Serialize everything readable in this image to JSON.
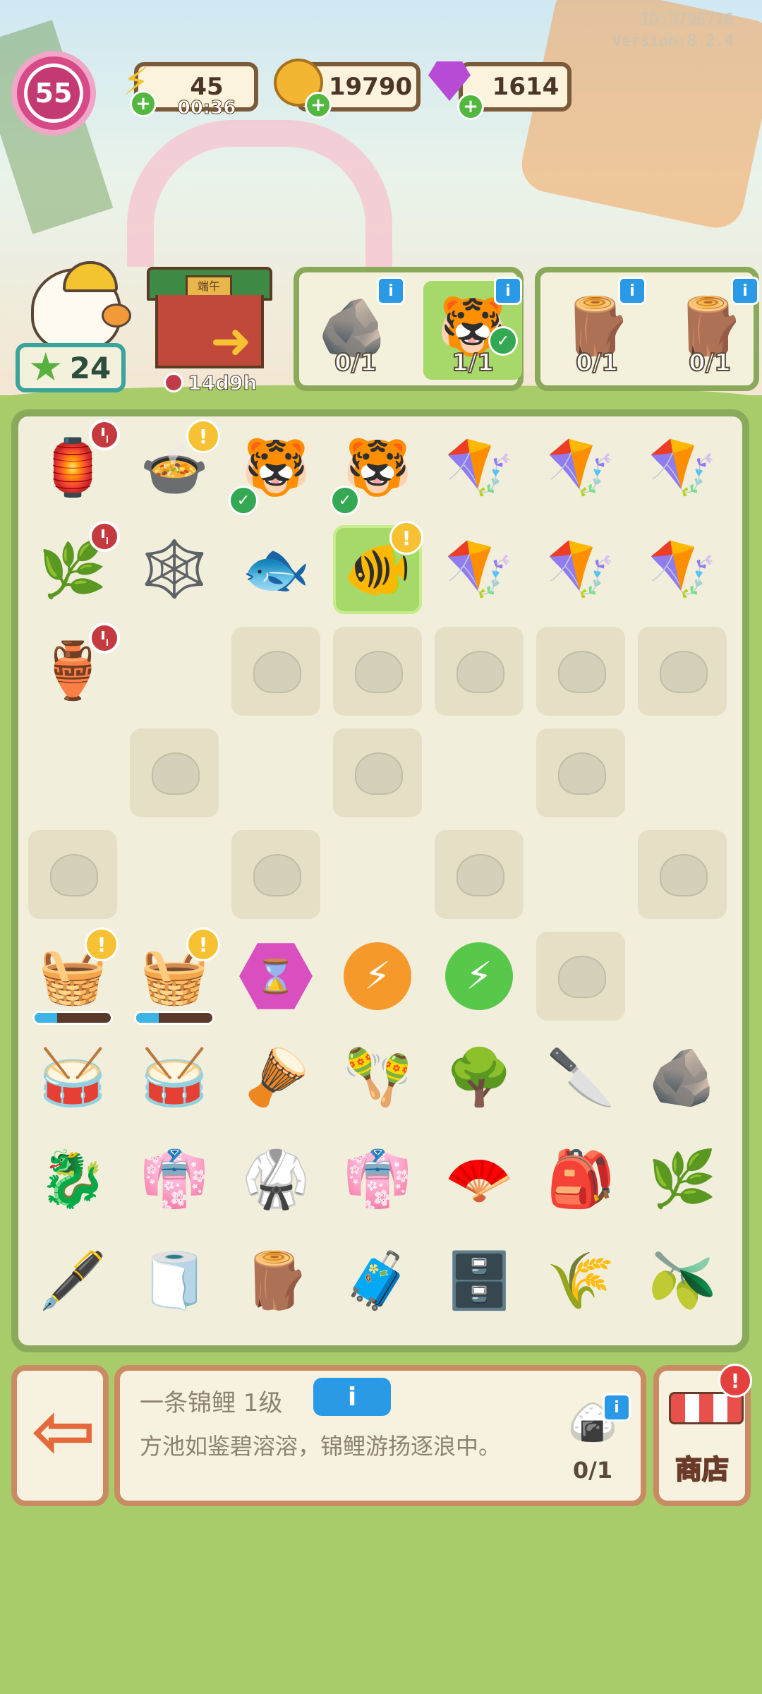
{
  "meta": {
    "id_text": "ID:3796716",
    "version_text": "Version:8.2.4"
  },
  "hud": {
    "level": "55",
    "energy": {
      "value": "45",
      "timer": "00:36"
    },
    "coins": {
      "value": "19790"
    },
    "gems": {
      "value": "1614"
    }
  },
  "player": {
    "star_count": "24"
  },
  "event": {
    "sign_text": "端午",
    "timer": "14d9h"
  },
  "orders": [
    {
      "items": [
        {
          "icon": "ink-stone",
          "count": "0/1",
          "done": false
        },
        {
          "icon": "tiger-sachet",
          "count": "1/1",
          "done": true
        }
      ]
    },
    {
      "items": [
        {
          "icon": "wood-plank",
          "count": "0/1",
          "done": false
        },
        {
          "icon": "wood-pile",
          "count": "0/1",
          "done": false
        }
      ]
    }
  ],
  "board": {
    "rows": [
      [
        {
          "icon": "market-stall",
          "emoji": "🏮",
          "badge": "clock"
        },
        {
          "icon": "cauldron",
          "emoji": "🍲",
          "badge": "excl"
        },
        {
          "icon": "tiger-sachet",
          "emoji": "🐯",
          "badge": "check"
        },
        {
          "icon": "tiger-sachet",
          "emoji": "🐯",
          "badge": "check"
        },
        {
          "icon": "swallow-kite",
          "emoji": "🪁"
        },
        {
          "icon": "swallow-kite",
          "emoji": "🪁"
        },
        {
          "icon": "swallow-kite",
          "emoji": "🪁"
        }
      ],
      [
        {
          "icon": "bamboo-leaves",
          "emoji": "🌿",
          "badge": "clock"
        },
        {
          "icon": "spider-web-rock",
          "emoji": "🕸️"
        },
        {
          "icon": "koi-fish",
          "emoji": "🐟"
        },
        {
          "icon": "koi-fish",
          "emoji": "🐠",
          "selected": true,
          "badge": "excl"
        },
        {
          "icon": "swallow-kite",
          "emoji": "🪁"
        },
        {
          "icon": "swallow-kite",
          "emoji": "🪁"
        },
        {
          "icon": "swallow-kite",
          "emoji": "🪁"
        }
      ],
      [
        {
          "icon": "wine-jar",
          "emoji": "🏺",
          "badge": "clock"
        },
        {
          "icon": "empty"
        },
        {
          "icon": "locked"
        },
        {
          "icon": "locked"
        },
        {
          "icon": "locked"
        },
        {
          "icon": "locked"
        },
        {
          "icon": "locked"
        }
      ],
      [
        {
          "icon": "empty"
        },
        {
          "icon": "locked"
        },
        {
          "icon": "empty"
        },
        {
          "icon": "locked"
        },
        {
          "icon": "empty"
        },
        {
          "icon": "locked"
        },
        {
          "icon": "empty"
        }
      ],
      [
        {
          "icon": "locked"
        },
        {
          "icon": "empty"
        },
        {
          "icon": "locked"
        },
        {
          "icon": "empty"
        },
        {
          "icon": "locked"
        },
        {
          "icon": "empty"
        },
        {
          "icon": "locked"
        }
      ],
      [
        {
          "icon": "rice-basket",
          "emoji": "🧺",
          "badge": "excl",
          "progress": 0.3
        },
        {
          "icon": "rice-basket",
          "emoji": "🧺",
          "badge": "excl",
          "progress": 0.3
        },
        {
          "icon": "hourglass-gem",
          "type": "hexgem",
          "label": "⌛"
        },
        {
          "icon": "energy-orb-orange",
          "type": "orb",
          "color": "#f59a2a",
          "label": "⚡"
        },
        {
          "icon": "energy-orb-green",
          "type": "orb",
          "color": "#58c84a",
          "label": "⚡"
        },
        {
          "icon": "locked"
        },
        {
          "icon": "empty"
        }
      ],
      [
        {
          "icon": "big-drum",
          "emoji": "🥁"
        },
        {
          "icon": "drum-with-sticks",
          "emoji": "🥁"
        },
        {
          "icon": "tambourine",
          "emoji": "🪘"
        },
        {
          "icon": "rattle-drum",
          "emoji": "🪇"
        },
        {
          "icon": "tree-branch",
          "emoji": "🌳"
        },
        {
          "icon": "sickle",
          "emoji": "🔪"
        },
        {
          "icon": "stone-mill",
          "emoji": "🪨"
        }
      ],
      [
        {
          "icon": "dragon-boat",
          "emoji": "🐉"
        },
        {
          "icon": "pink-hanfu",
          "emoji": "👘"
        },
        {
          "icon": "black-hanfu",
          "emoji": "🥋"
        },
        {
          "icon": "green-hanfu",
          "emoji": "👘"
        },
        {
          "icon": "hand-fan",
          "emoji": "🪭"
        },
        {
          "icon": "red-gourd-sachet",
          "emoji": "🎒"
        },
        {
          "icon": "herb-leaves",
          "emoji": "🌿"
        }
      ],
      [
        {
          "icon": "ink-bottle",
          "emoji": "🖋️"
        },
        {
          "icon": "folded-cloth",
          "emoji": "🧻"
        },
        {
          "icon": "wood-log",
          "emoji": "🪵"
        },
        {
          "icon": "wooden-chest",
          "emoji": "🧳"
        },
        {
          "icon": "small-chest",
          "emoji": "🗄️"
        },
        {
          "icon": "rice-sack",
          "emoji": "🌾"
        },
        {
          "icon": "green-plums",
          "emoji": "🫒"
        }
      ]
    ]
  },
  "info_panel": {
    "title": "一条锦鲤 1级",
    "info_button": "i",
    "description": "方池如鉴碧溶溶，锦鲤游扬逐浪中。",
    "requirement_count": "0/1"
  },
  "shop": {
    "label": "商店"
  }
}
